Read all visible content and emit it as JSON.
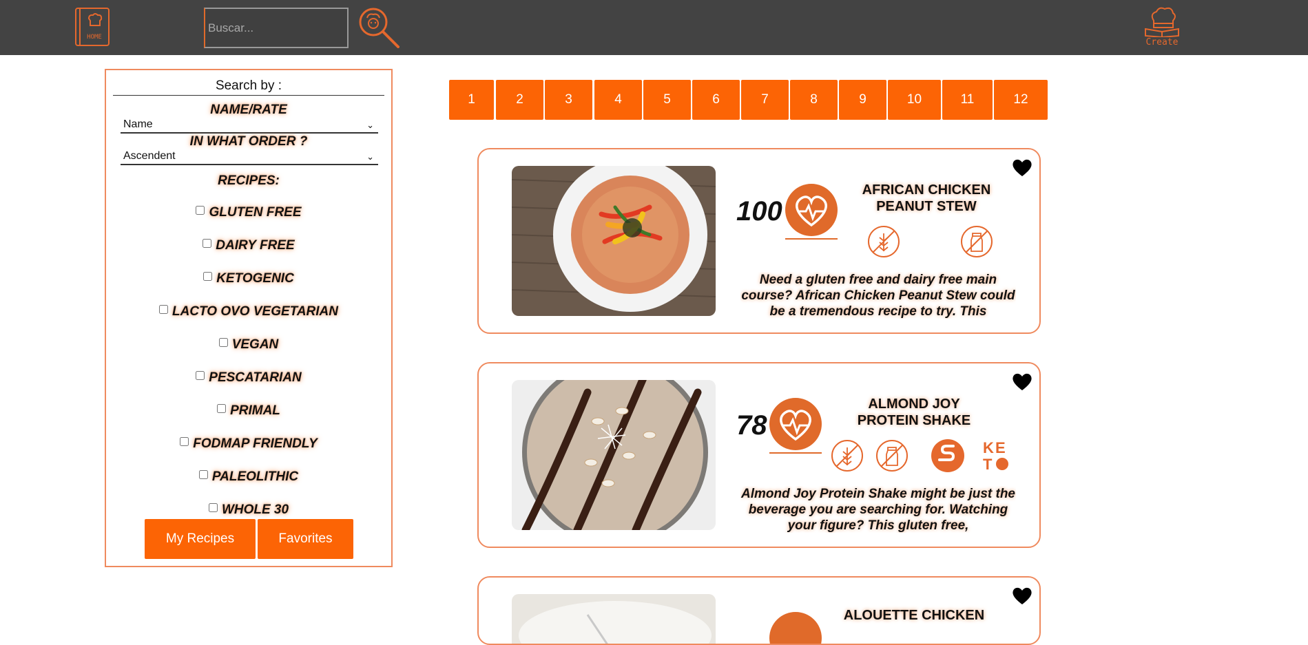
{
  "nav": {
    "home_label": "HOME",
    "search_placeholder": "Buscar...",
    "create_label": "Create"
  },
  "sidebar": {
    "title": "Search by :",
    "sort_heading": "NAME/RATE",
    "sort_value": "Name",
    "order_heading": "IN WHAT ORDER ?",
    "order_value": "Ascendent",
    "recipes_heading": "RECIPES:",
    "diets": [
      "GLUTEN FREE",
      "DAIRY FREE",
      "KETOGENIC",
      "LACTO OVO VEGETARIAN",
      "VEGAN",
      "PESCATARIAN",
      "PRIMAL",
      "FODMAP FRIENDLY",
      "PALEOLITHIC",
      "WHOLE 30"
    ],
    "my_recipes_label": "My Recipes",
    "favorites_label": "Favorites"
  },
  "pagination": [
    "1",
    "2",
    "3",
    "4",
    "5",
    "6",
    "7",
    "8",
    "9",
    "10",
    "11",
    "12"
  ],
  "recipes": [
    {
      "score": "100",
      "title": "AFRICAN CHICKEN PEANUT STEW",
      "description": "Need a gluten free and dairy free main course? African Chicken Peanut Stew could be a tremendous recipe to try. This",
      "diet_icons": [
        "gluten-free-icon",
        "dairy-free-icon"
      ]
    },
    {
      "score": "78",
      "title": "ALMOND JOY PROTEIN SHAKE",
      "description": "Almond Joy Protein Shake might be just the beverage you are searching for. Watching your figure? This gluten free,",
      "diet_icons": [
        "gluten-free-icon",
        "dairy-free-icon",
        "fodmap-icon",
        "keto-icon"
      ],
      "keto_text": "KETO"
    },
    {
      "title": "ALOUETTE CHICKEN"
    }
  ],
  "colors": {
    "accent": "#fc6405",
    "topbar": "#434343",
    "icon": "#e5682d",
    "border": "#ef8a5e"
  }
}
